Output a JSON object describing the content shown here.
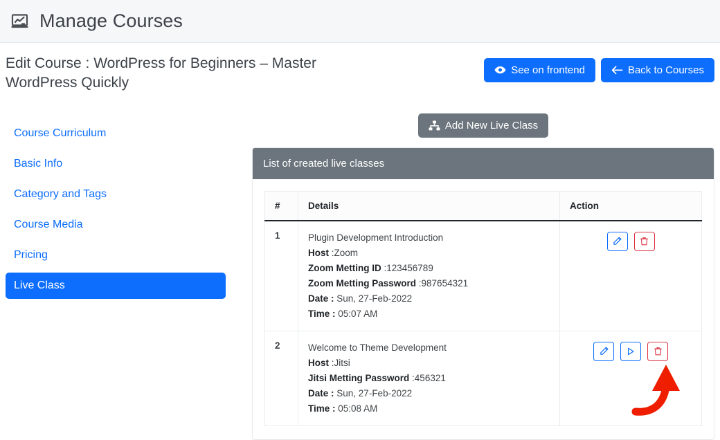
{
  "header": {
    "title": "Manage Courses",
    "icon": "chalkboard-chart-icon"
  },
  "subheader": {
    "course_title": "Edit Course : WordPress for Beginners – Master WordPress Quickly",
    "see_frontend_label": "See on frontend",
    "see_frontend_icon": "eye-icon",
    "back_label": "Back to Courses",
    "back_icon": "arrow-left-icon"
  },
  "sidebar": {
    "items": [
      {
        "label": "Course Curriculum",
        "active": false
      },
      {
        "label": "Basic Info",
        "active": false
      },
      {
        "label": "Category and Tags",
        "active": false
      },
      {
        "label": "Course Media",
        "active": false
      },
      {
        "label": "Pricing",
        "active": false
      },
      {
        "label": "Live Class",
        "active": true
      }
    ]
  },
  "main": {
    "add_button_label": "Add New Live Class",
    "add_button_icon": "sitemap-icon",
    "panel_title": "List of created live classes",
    "table": {
      "columns": [
        "#",
        "Details",
        "Action"
      ],
      "rows": [
        {
          "num": "1",
          "name": "Plugin Development Introduction",
          "fields": [
            {
              "label": "Host",
              "sep": " :",
              "value": "Zoom"
            },
            {
              "label": "Zoom Metting ID",
              "sep": " :",
              "value": "123456789"
            },
            {
              "label": "Zoom Metting Password",
              "sep": " :",
              "value": "987654321"
            },
            {
              "label": "Date :",
              "sep": " ",
              "value": "Sun, 27-Feb-2022"
            },
            {
              "label": "Time :",
              "sep": " ",
              "value": "05:07 AM"
            }
          ],
          "actions": [
            {
              "name": "edit",
              "icon": "pencil-icon",
              "style": "blue"
            },
            {
              "name": "delete",
              "icon": "trash-icon",
              "style": "red"
            }
          ]
        },
        {
          "num": "2",
          "name": "Welcome to Theme Development",
          "fields": [
            {
              "label": "Host",
              "sep": " :",
              "value": "Jitsi"
            },
            {
              "label": "Jitsi Metting Password",
              "sep": " :",
              "value": "456321"
            },
            {
              "label": "Date :",
              "sep": " ",
              "value": "Sun, 27-Feb-2022"
            },
            {
              "label": "Time :",
              "sep": " ",
              "value": "05:08 AM"
            }
          ],
          "actions": [
            {
              "name": "edit",
              "icon": "pencil-icon",
              "style": "blue"
            },
            {
              "name": "join",
              "icon": "play-icon",
              "style": "blue"
            },
            {
              "name": "delete",
              "icon": "trash-icon",
              "style": "red"
            }
          ]
        }
      ]
    }
  },
  "annotation": {
    "type": "curved-arrow",
    "points_to": "delete-button-row-2",
    "color": "#f01e00"
  },
  "colors": {
    "accent_blue": "#0d6efd",
    "slate": "#6c757d",
    "danger_red": "#dc3545",
    "topbar_bg": "#f6f7f9",
    "annotation_red": "#f01e00"
  }
}
